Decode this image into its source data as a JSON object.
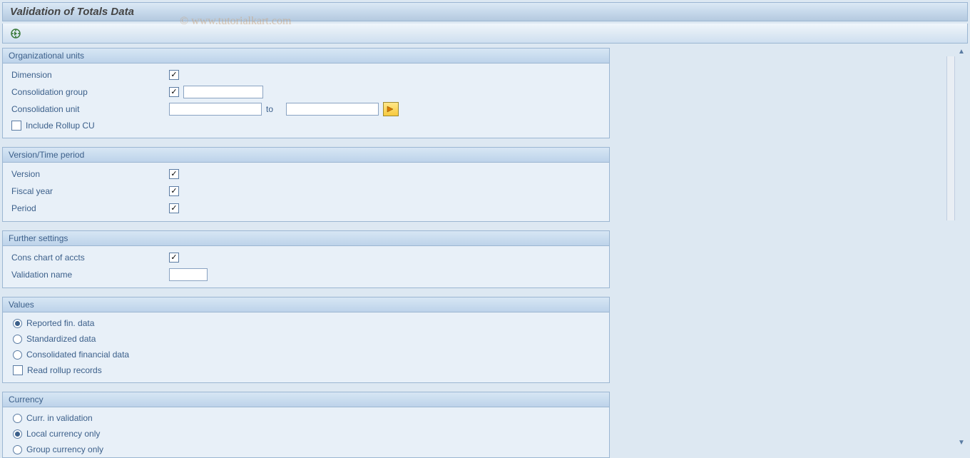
{
  "title": "Validation of Totals Data",
  "watermark": "© www.tutorialkart.com",
  "groups": {
    "org": {
      "header": "Organizational units",
      "dimension_label": "Dimension",
      "cons_group_label": "Consolidation group",
      "cons_unit_label": "Consolidation unit",
      "to_label": "to",
      "include_rollup_label": "Include Rollup CU"
    },
    "version": {
      "header": "Version/Time period",
      "version_label": "Version",
      "fiscal_year_label": "Fiscal year",
      "period_label": "Period"
    },
    "further": {
      "header": "Further settings",
      "cons_chart_label": "Cons chart of accts",
      "validation_name_label": "Validation name"
    },
    "values": {
      "header": "Values",
      "reported": "Reported fin. data",
      "standardized": "Standardized data",
      "consolidated": "Consolidated financial data",
      "read_rollup": "Read rollup records"
    },
    "currency": {
      "header": "Currency",
      "curr_validation": "Curr. in validation",
      "local_only": "Local currency only",
      "group_only": "Group currency only"
    }
  },
  "state": {
    "dimension_checked": true,
    "cons_group_checked": true,
    "cons_group_value": "",
    "cons_unit_from": "",
    "cons_unit_to": "",
    "include_rollup_checked": false,
    "version_checked": true,
    "fiscal_year_checked": true,
    "period_checked": true,
    "cons_chart_checked": true,
    "validation_name_value": "",
    "values_selected": "reported",
    "read_rollup_checked": false,
    "currency_selected": "local"
  }
}
